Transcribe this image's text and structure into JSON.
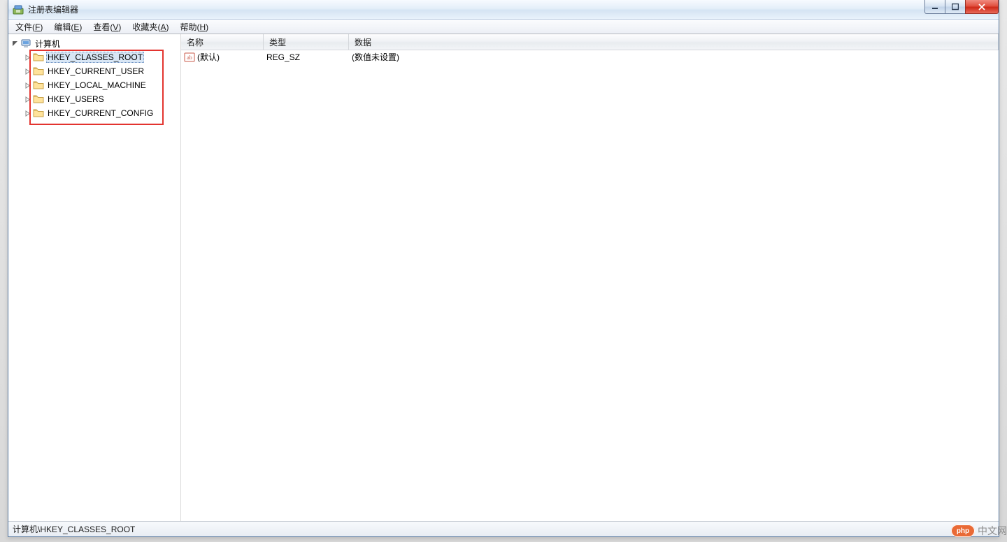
{
  "window": {
    "title": "注册表编辑器"
  },
  "menu": {
    "items": [
      {
        "label": "文件",
        "accel": "F"
      },
      {
        "label": "编辑",
        "accel": "E"
      },
      {
        "label": "查看",
        "accel": "V"
      },
      {
        "label": "收藏夹",
        "accel": "A"
      },
      {
        "label": "帮助",
        "accel": "H"
      }
    ]
  },
  "tree": {
    "root_label": "计算机",
    "selected": 0,
    "hives": [
      "HKEY_CLASSES_ROOT",
      "HKEY_CURRENT_USER",
      "HKEY_LOCAL_MACHINE",
      "HKEY_USERS",
      "HKEY_CURRENT_CONFIG"
    ]
  },
  "list": {
    "columns": {
      "name": "名称",
      "type": "类型",
      "data": "数据"
    },
    "rows": [
      {
        "name": "(默认)",
        "type": "REG_SZ",
        "data": "(数值未设置)"
      }
    ]
  },
  "status": {
    "path": "计算机\\HKEY_CLASSES_ROOT"
  },
  "watermark": {
    "logo_text": "php",
    "text": "中文网"
  }
}
